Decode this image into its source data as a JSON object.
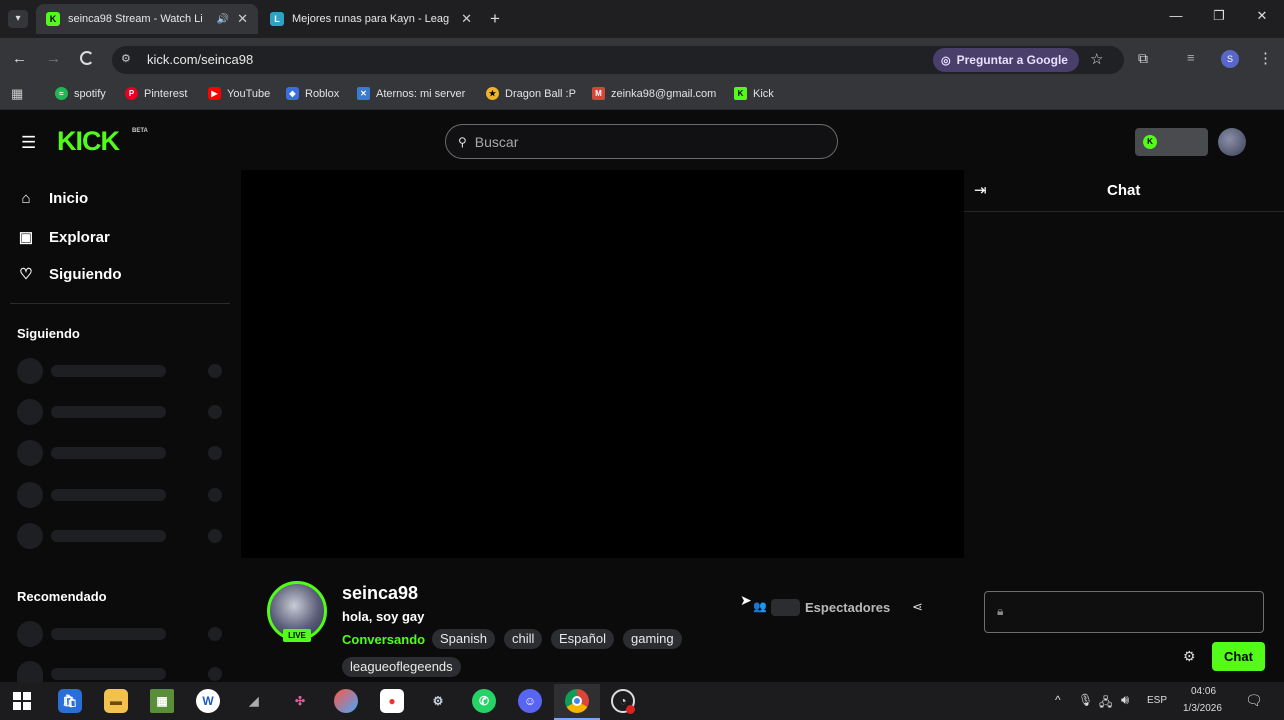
{
  "browser": {
    "tabs": [
      {
        "title": "seinca98 Stream - Watch Li",
        "active": true
      },
      {
        "title": "Mejores runas para Kayn - Leag",
        "active": false
      }
    ],
    "url": "kick.com/seinca98",
    "ask_google": "Preguntar a Google",
    "profile_initial": "S",
    "bookmarks": [
      "spotify",
      "Pinterest",
      "YouTube",
      "Roblox",
      "Aternos: mi server",
      "Dragon Ball :P",
      "zeinka98@gmail.com",
      "Kick"
    ]
  },
  "kick": {
    "logo": "KICK",
    "logo_badge": "BETA",
    "search_placeholder": "Buscar",
    "nav": [
      "Inicio",
      "Explorar",
      "Siguiendo"
    ],
    "following_header": "Siguiendo",
    "recommended_header": "Recomendado",
    "chat_title": "Chat",
    "chat_button": "Chat",
    "streamer": {
      "name": "seinca98",
      "title": "hola, soy gay",
      "live_badge": "LIVE",
      "category": "Conversando",
      "tags": [
        "Spanish",
        "chill",
        "Español",
        "gaming",
        "leagueoflegeends"
      ],
      "viewers_label": "Espectadores"
    }
  },
  "taskbar": {
    "lang": "ESP",
    "time": "04:06",
    "date": "1/3/2026"
  },
  "colors": {
    "kick_green": "#53fc18",
    "chrome_bg": "#35363a"
  }
}
